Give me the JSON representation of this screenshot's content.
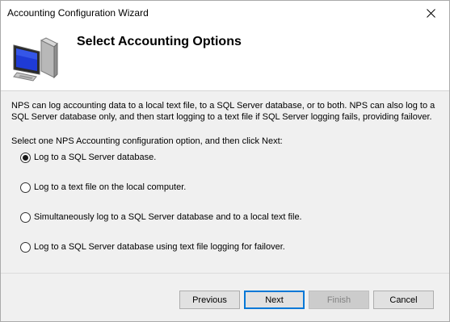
{
  "window": {
    "title": "Accounting Configuration Wizard",
    "close_glyph": "✕"
  },
  "header": {
    "title": "Select Accounting Options",
    "icon": "computer-monitor-icon"
  },
  "body": {
    "description": "NPS can log accounting data to a local text file, to a SQL Server database, or to both. NPS can also log to a SQL Server database only, and then start logging to a text file if SQL Server logging fails, providing failover.",
    "prompt": "Select one NPS Accounting configuration option, and then click Next:",
    "options": [
      {
        "label": "Log to a SQL Server database.",
        "selected": true
      },
      {
        "label": "Log to a text file on the local computer.",
        "selected": false
      },
      {
        "label": "Simultaneously log to a SQL Server database and to a local text file.",
        "selected": false
      },
      {
        "label": "Log to a SQL Server database using text file logging for failover.",
        "selected": false
      }
    ]
  },
  "footer": {
    "previous_label": "Previous",
    "next_label": "Next",
    "finish_label": "Finish",
    "cancel_label": "Cancel",
    "finish_disabled": true
  },
  "colors": {
    "dialog_bg": "#f0f0f0",
    "header_bg": "#ffffff",
    "default_button_border": "#0078d7",
    "monitor_screen": "#1f3bd6"
  }
}
